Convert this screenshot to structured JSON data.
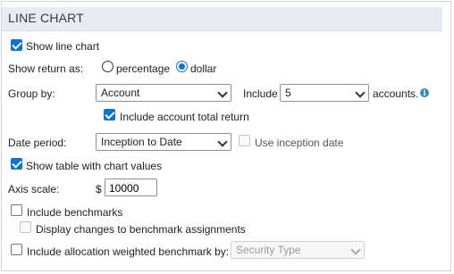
{
  "section": {
    "title": "LINE CHART"
  },
  "show_line_chart": {
    "label": "Show line chart",
    "checked": true
  },
  "show_return_as": {
    "label": "Show return as:",
    "options": [
      {
        "label": "percentage",
        "selected": false
      },
      {
        "label": "dollar",
        "selected": true
      }
    ]
  },
  "group_by": {
    "label": "Group by:",
    "value": "Account",
    "include_label": "Include",
    "include_value": "5",
    "accounts_label": "accounts.",
    "info_icon": "info-icon"
  },
  "include_account_total_return": {
    "label": "Include account total return",
    "checked": true
  },
  "date_period": {
    "label": "Date period:",
    "value": "Inception to Date",
    "use_inception_date_label": "Use inception date",
    "use_inception_date_checked": false
  },
  "show_table": {
    "label": "Show table with chart values",
    "checked": true
  },
  "axis_scale": {
    "label": "Axis scale:",
    "currency": "$",
    "value": "10000"
  },
  "include_benchmarks": {
    "label": "Include benchmarks",
    "checked": false
  },
  "display_changes": {
    "label": "Display changes to benchmark assignments",
    "checked": false
  },
  "include_allocation": {
    "label": "Include allocation weighted benchmark by:",
    "checked": false,
    "select_value": "Security Type"
  },
  "colors": {
    "accent": "#0a74d6",
    "header_bg": "#e8ecf2",
    "border": "#cfd4da"
  }
}
